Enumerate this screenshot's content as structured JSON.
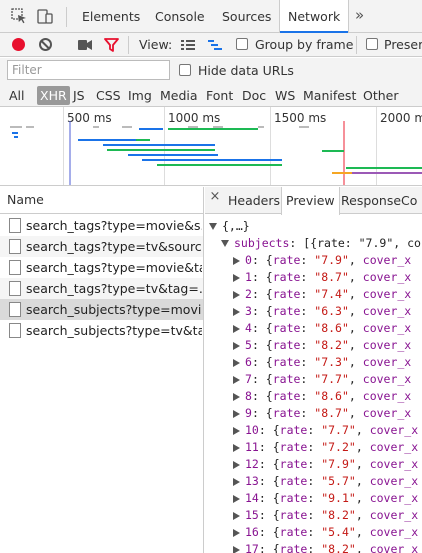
{
  "devtools_tabs": [
    {
      "label": "Elements",
      "active": false
    },
    {
      "label": "Console",
      "active": false
    },
    {
      "label": "Sources",
      "active": false
    },
    {
      "label": "Network",
      "active": true
    }
  ],
  "more_tabs_glyph": "»",
  "toolbar": {
    "view_label": "View:",
    "group_by_frame_label": "Group by frame",
    "group_by_frame_checked": false,
    "preserve_label": "Preserv",
    "preserve_checked": false
  },
  "filter": {
    "placeholder": "Filter",
    "value": "",
    "hide_data_urls_label": "Hide data URLs",
    "hide_data_urls_checked": false
  },
  "resource_types": [
    {
      "label": "All",
      "selected": false
    },
    {
      "label": "XHR",
      "selected": true
    },
    {
      "label": "JS",
      "selected": false
    },
    {
      "label": "CSS",
      "selected": false
    },
    {
      "label": "Img",
      "selected": false
    },
    {
      "label": "Media",
      "selected": false
    },
    {
      "label": "Font",
      "selected": false
    },
    {
      "label": "Doc",
      "selected": false
    },
    {
      "label": "WS",
      "selected": false
    },
    {
      "label": "Manifest",
      "selected": false
    },
    {
      "label": "Other",
      "selected": false
    }
  ],
  "overview": {
    "tick_labels": [
      "500 ms",
      "1000 ms",
      "1500 ms",
      "2000 m"
    ]
  },
  "request_list": {
    "header": "Name",
    "requests": [
      {
        "name": "search_tags?type=movie&s..."
      },
      {
        "name": "search_tags?type=tv&sourc..."
      },
      {
        "name": "search_tags?type=movie&ta..."
      },
      {
        "name": "search_tags?type=tv&tag=..."
      },
      {
        "name": "search_subjects?type=movie..."
      },
      {
        "name": "search_subjects?type=tv&ta..."
      }
    ],
    "selected_index": 4
  },
  "detail_tabs": [
    {
      "label": "Headers",
      "active": false
    },
    {
      "label": "Preview",
      "active": true
    },
    {
      "label": "Response",
      "active": false
    },
    {
      "label": "Co",
      "active": false
    }
  ],
  "close_glyph": "×",
  "preview": {
    "root": "{,…}",
    "subjects_key": "subjects",
    "subjects_summary": "[{rate: \"7.9\", co",
    "items": [
      {
        "index": "0",
        "rate": "7.9"
      },
      {
        "index": "1",
        "rate": "8.7"
      },
      {
        "index": "2",
        "rate": "7.4"
      },
      {
        "index": "3",
        "rate": "6.3"
      },
      {
        "index": "4",
        "rate": "8.6"
      },
      {
        "index": "5",
        "rate": "8.2"
      },
      {
        "index": "6",
        "rate": "7.3"
      },
      {
        "index": "7",
        "rate": "7.7"
      },
      {
        "index": "8",
        "rate": "8.6"
      },
      {
        "index": "9",
        "rate": "8.7"
      },
      {
        "index": "10",
        "rate": "7.7"
      },
      {
        "index": "11",
        "rate": "7.2"
      },
      {
        "index": "12",
        "rate": "7.9"
      },
      {
        "index": "13",
        "rate": "5.7"
      },
      {
        "index": "14",
        "rate": "9.1"
      },
      {
        "index": "15",
        "rate": "8.2"
      },
      {
        "index": "16",
        "rate": "5.4"
      },
      {
        "index": "17",
        "rate": "8.2"
      }
    ],
    "item_suffix": "cover_x"
  },
  "colors": {
    "record_red": "#e8102e",
    "key_purple": "#881391",
    "string_red": "#c41a16",
    "active_tab_blue": "#1a73e8",
    "selected_type_gray": "#999999"
  }
}
